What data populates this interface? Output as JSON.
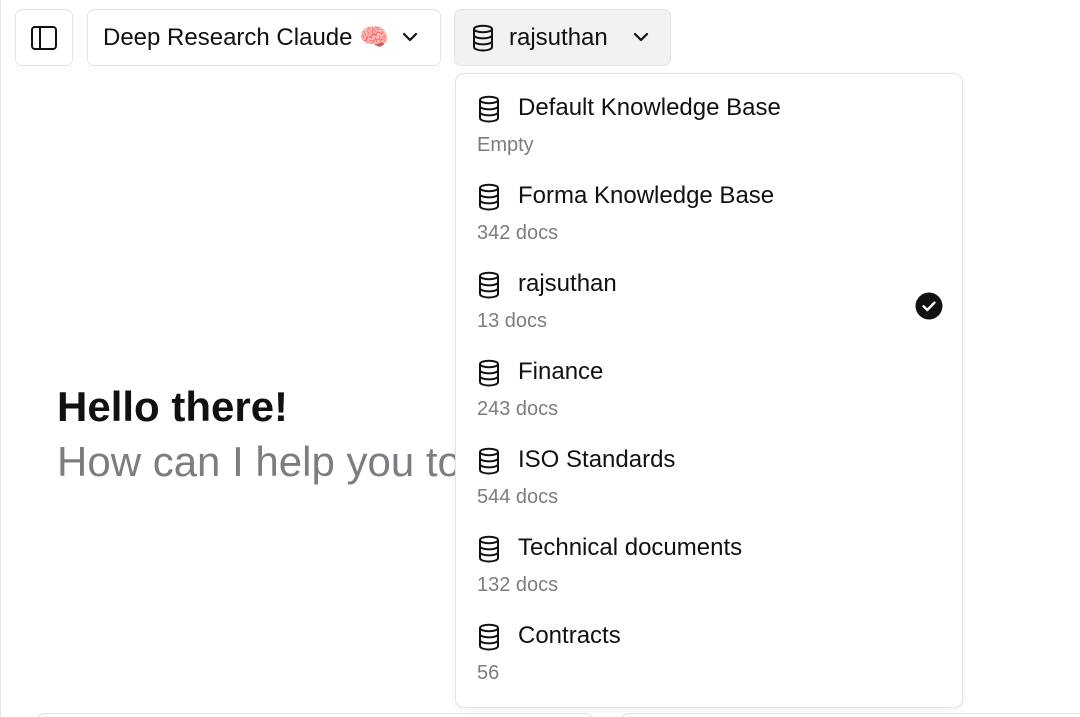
{
  "header": {
    "model_label": "Deep Research Claude 🧠",
    "kb_label": "rajsuthan"
  },
  "icons": {
    "sidebar_toggle": "sidebar-panel-icon",
    "model_chevron": "chevron-down-icon",
    "kb": "database-icon",
    "selected": "check-circle-icon"
  },
  "hero": {
    "title": "Hello there!",
    "subtitle": "How can I help you to"
  },
  "knowledge_bases": [
    {
      "name": "Default Knowledge Base",
      "meta": "Empty",
      "selected": false
    },
    {
      "name": "Forma Knowledge Base",
      "meta": "342 docs",
      "selected": false
    },
    {
      "name": "rajsuthan",
      "meta": "13 docs",
      "selected": true
    },
    {
      "name": "Finance",
      "meta": "243 docs",
      "selected": false
    },
    {
      "name": "ISO Standards",
      "meta": "544 docs",
      "selected": false
    },
    {
      "name": "Technical documents",
      "meta": "132 docs",
      "selected": false
    },
    {
      "name": "Contracts",
      "meta": "56",
      "selected": false
    }
  ],
  "colors": {
    "text": "#111111",
    "muted": "#7b7d82",
    "border": "#e3e3e3",
    "selected_button_bg": "#f2f2f3"
  }
}
